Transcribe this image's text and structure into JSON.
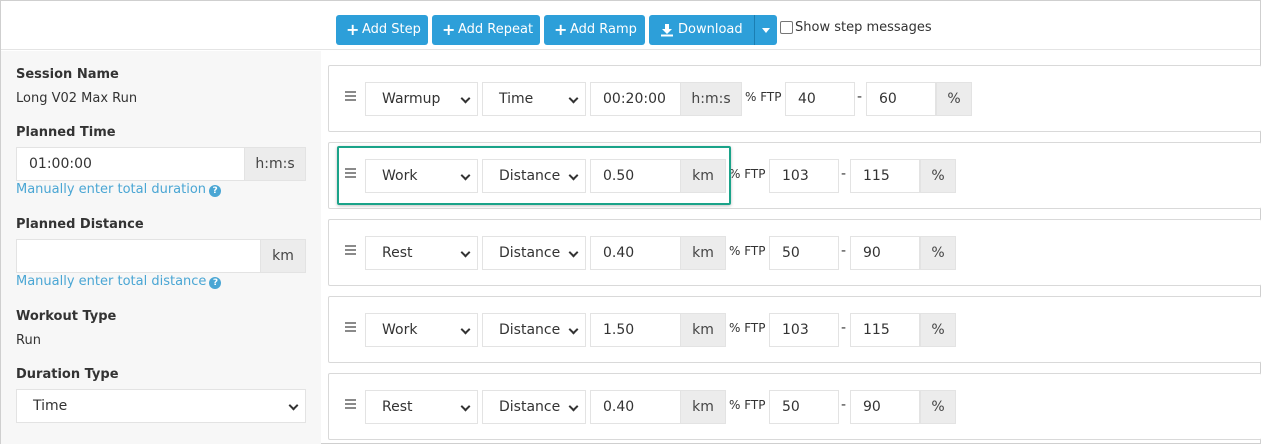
{
  "toolbar": {
    "add_step": "Add Step",
    "add_repeat": "Add Repeat",
    "add_ramp": "Add Ramp",
    "download": "Download",
    "show_step_messages": "Show step messages"
  },
  "session": {
    "name_label": "Session Name",
    "name_value": "Long V02 Max Run",
    "planned_time_label": "Planned Time",
    "planned_time_value": "01:00:00",
    "planned_time_unit": "h:m:s",
    "manual_duration_link": "Manually enter total duration",
    "planned_distance_label": "Planned Distance",
    "planned_distance_value": "",
    "planned_distance_unit": "km",
    "manual_distance_link": "Manually enter total distance",
    "workout_type_label": "Workout Type",
    "workout_type_value": "Run",
    "duration_type_label": "Duration Type",
    "duration_type_value": "Time"
  },
  "ftp_label": "% FTP",
  "percent_label": "%",
  "dash": "-",
  "steps": [
    {
      "type": "Warmup",
      "measure": "Time",
      "amount": "00:20:00",
      "unit": "h:m:s",
      "low": "40",
      "high": "60"
    },
    {
      "type": "Work",
      "measure": "Distance",
      "amount": "0.50",
      "unit": "km",
      "low": "103",
      "high": "115"
    },
    {
      "type": "Rest",
      "measure": "Distance",
      "amount": "0.40",
      "unit": "km",
      "low": "50",
      "high": "90"
    },
    {
      "type": "Work",
      "measure": "Distance",
      "amount": "1.50",
      "unit": "km",
      "low": "103",
      "high": "115"
    },
    {
      "type": "Rest",
      "measure": "Distance",
      "amount": "0.40",
      "unit": "km",
      "low": "50",
      "high": "90"
    }
  ],
  "colors": {
    "button": "#2d9fd9",
    "link": "#4aa6d4",
    "highlight": "#1aa389"
  }
}
